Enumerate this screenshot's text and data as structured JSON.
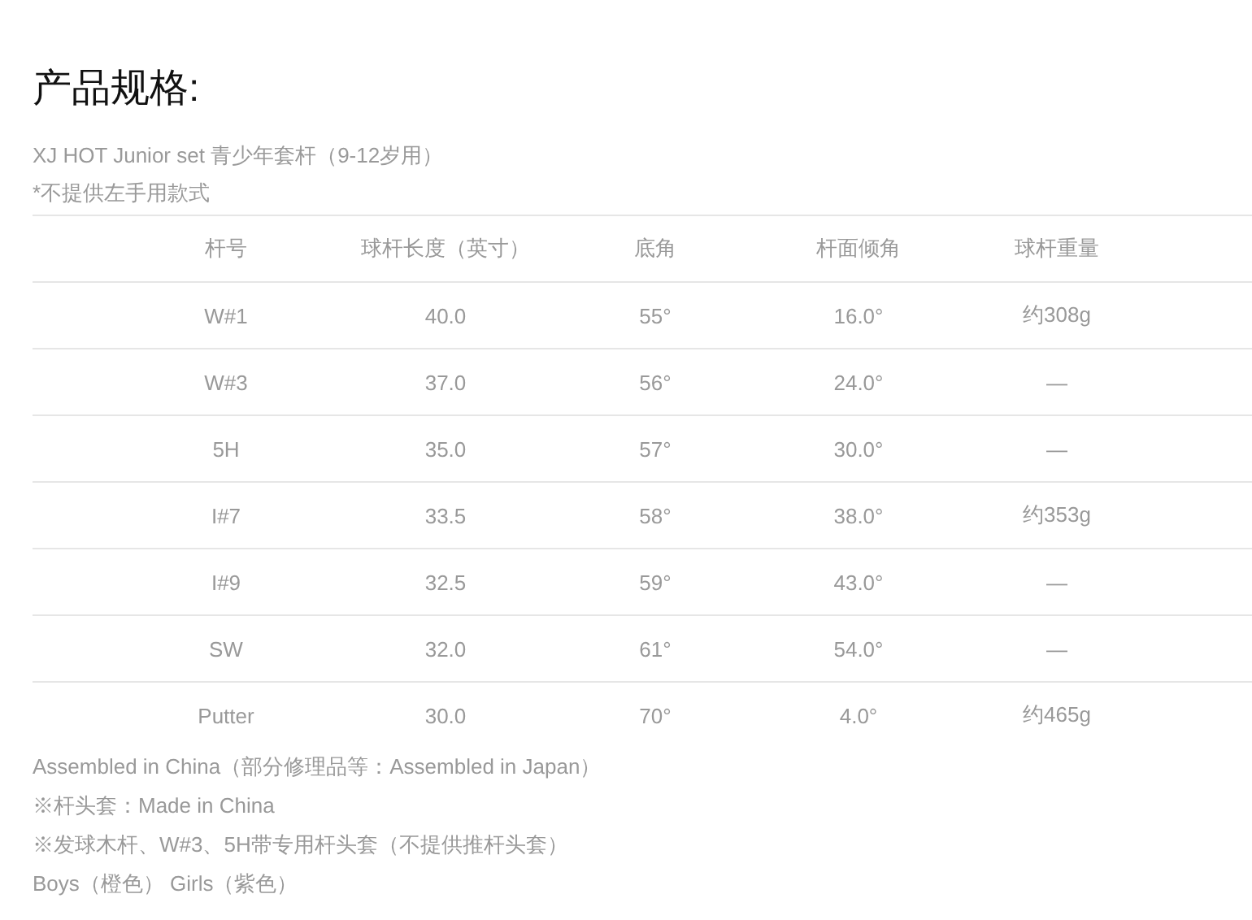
{
  "heading": "产品规格:",
  "intro": [
    "XJ HOT Junior set 青少年套杆（9-12岁用）",
    "*不提供左手用款式"
  ],
  "table": {
    "columns": [
      "杆号",
      "球杆长度（英寸）",
      "底角",
      "杆面倾角",
      "球杆重量"
    ],
    "rows": [
      [
        "W#1",
        "40.0",
        "55°",
        "16.0°",
        "约308g"
      ],
      [
        "W#3",
        "37.0",
        "56°",
        "24.0°",
        "—"
      ],
      [
        "5H",
        "35.0",
        "57°",
        "30.0°",
        "—"
      ],
      [
        "I#7",
        "33.5",
        "58°",
        "38.0°",
        "约353g"
      ],
      [
        "I#9",
        "32.5",
        "59°",
        "43.0°",
        "—"
      ],
      [
        "SW",
        "32.0",
        "61°",
        "54.0°",
        "—"
      ],
      [
        "Putter",
        "30.0",
        "70°",
        "4.0°",
        "约465g"
      ]
    ]
  },
  "notes": [
    "Assembled in China（部分修理品等：Assembled in Japan）",
    "※杆头套：Made in China",
    "※发球木杆、W#3、5H带专用杆头套（不提供推杆头套）",
    "Boys（橙色） Girls（紫色）"
  ]
}
